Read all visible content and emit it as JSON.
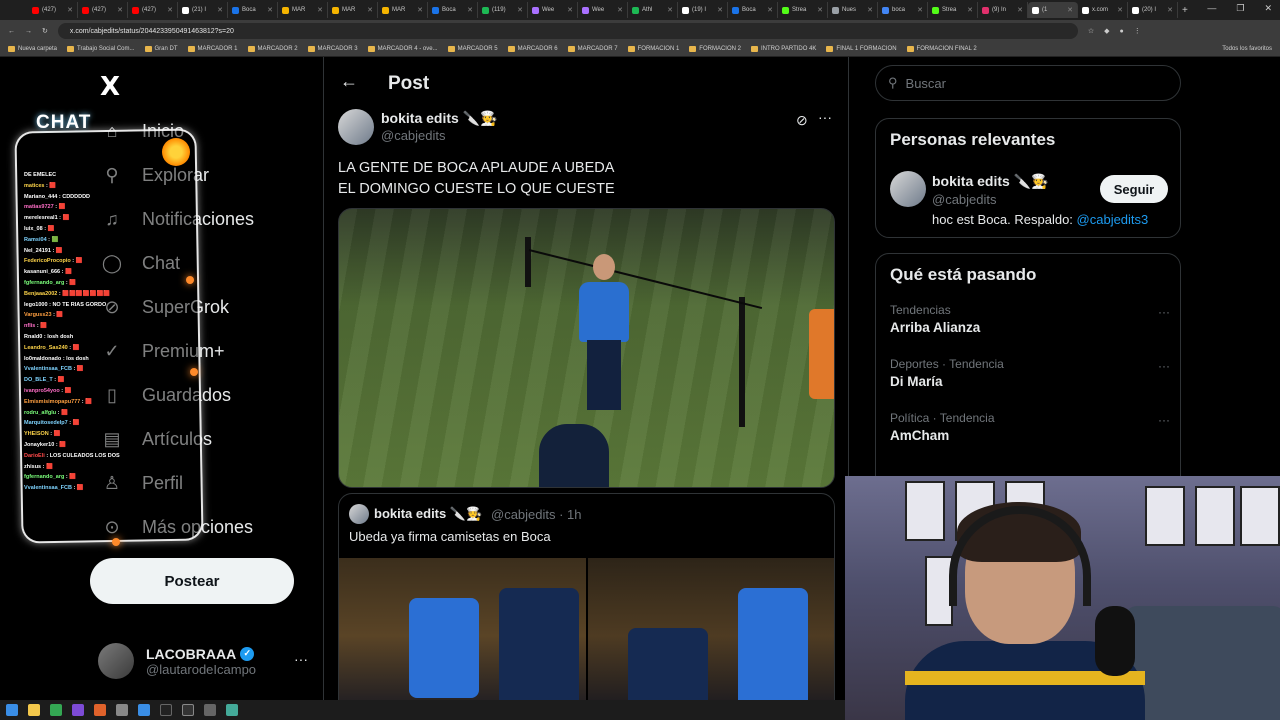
{
  "browser": {
    "tabs": [
      {
        "label": "(427)",
        "color": "#ff0000"
      },
      {
        "label": "(427)",
        "color": "#ff0000"
      },
      {
        "label": "(427)",
        "color": "#ff0000"
      },
      {
        "label": "(21) I",
        "color": "#ffffff"
      },
      {
        "label": "Boca",
        "color": "#1a73e8"
      },
      {
        "label": "MAR",
        "color": "#f5b400"
      },
      {
        "label": "MAR",
        "color": "#f5b400"
      },
      {
        "label": "MAR",
        "color": "#f5b400"
      },
      {
        "label": "Boca",
        "color": "#1a73e8"
      },
      {
        "label": "(119)",
        "color": "#1db954"
      },
      {
        "label": "Wee",
        "color": "#a970ff"
      },
      {
        "label": "Wee",
        "color": "#a970ff"
      },
      {
        "label": "Athl",
        "color": "#1db954"
      },
      {
        "label": "(19) I",
        "color": "#ffffff"
      },
      {
        "label": "Boca",
        "color": "#1a73e8"
      },
      {
        "label": "Strea",
        "color": "#53fc18"
      },
      {
        "label": "Nues",
        "color": "#9aa0a6"
      },
      {
        "label": "boca",
        "color": "#4285f4"
      },
      {
        "label": "Strea",
        "color": "#53fc18"
      },
      {
        "label": "(9) In",
        "color": "#e1306c"
      },
      {
        "label": "(1",
        "color": "#ffffff",
        "active": true
      },
      {
        "label": "x.com",
        "color": "#ffffff"
      },
      {
        "label": "(20) I",
        "color": "#ffffff"
      }
    ],
    "new_tab": "+",
    "url": "x.com/cabjedits/status/2044233950491463812?s=20",
    "bookmarks": [
      "Nueva carpeta",
      "Trabajo Social Com...",
      "Gran DT",
      "MARCADOR 1",
      "MARCADOR 2",
      "MARCADOR 3",
      "MARCADOR 4 - ove...",
      "MARCADOR 5",
      "MARCADOR 6",
      "MARCADOR 7",
      "FORMACION 1",
      "FORMACION 2",
      "INTRO PARTIDO 4K",
      "FINAL 1 FORMACION",
      "FORMACION FINAL 2"
    ],
    "bookmarks_right": "Todos los favoritos"
  },
  "nav": {
    "logo": "X",
    "items": [
      {
        "label": "Inicio",
        "icon": "home-icon",
        "glyph": "⌂"
      },
      {
        "label": "Explorar",
        "icon": "search-icon",
        "glyph": "⚲"
      },
      {
        "label": "Notificaciones",
        "icon": "bell-icon",
        "glyph": "♫"
      },
      {
        "label": "Chat",
        "icon": "chat-icon",
        "glyph": "◯"
      },
      {
        "label": "SuperGrok",
        "icon": "grok-icon",
        "glyph": "⊘"
      },
      {
        "label": "Premium+",
        "icon": "premium-icon",
        "glyph": "✓"
      },
      {
        "label": "Guardados",
        "icon": "bookmark-icon",
        "glyph": "▯"
      },
      {
        "label": "Artículos",
        "icon": "article-icon",
        "glyph": "▤"
      },
      {
        "label": "Perfil",
        "icon": "profile-icon",
        "glyph": "♙"
      },
      {
        "label": "Más opciones",
        "icon": "more-options-icon",
        "glyph": "⊙"
      }
    ],
    "post_button": "Postear",
    "account": {
      "name": "LACOBRAAA",
      "handle": "@lautarodeIcampo",
      "more": "···"
    }
  },
  "stream_chat": {
    "title": "CHAT",
    "lines": [
      {
        "user": "DE EMELEC",
        "color": "#ffffff",
        "msg": ""
      },
      {
        "user": "matices",
        "color": "#ffd54a",
        "msg": ": 🟥"
      },
      {
        "user": "Mariano_444",
        "color": "#ffffff",
        "msg": ": CDDDDDD"
      },
      {
        "user": "matias9727",
        "color": "#ff6ec7",
        "msg": ": 🟥"
      },
      {
        "user": "merelesreal1",
        "color": "#ffffff",
        "msg": ": 🟥"
      },
      {
        "user": "luix_08",
        "color": "#ffffff",
        "msg": ": 🟥"
      },
      {
        "user": "Ramsi04",
        "color": "#7fd4ff",
        "msg": ": 🟩"
      },
      {
        "user": "Nel_24191",
        "color": "#ffffff",
        "msg": ": 🟥"
      },
      {
        "user": "FedericoProcopio",
        "color": "#ffd54a",
        "msg": ": 🟥"
      },
      {
        "user": "kasanuni_666",
        "color": "#ffffff",
        "msg": ": 🟥"
      },
      {
        "user": "fgfernando_arg",
        "color": "#7bff7b",
        "msg": ": 🟥"
      },
      {
        "user": "Benjaaa2002",
        "color": "#ffd54a",
        "msg": ": 🟥🟥🟥🟥🟥🟥🟥"
      },
      {
        "user": "lego1000",
        "color": "#ffffff",
        "msg": ": NO TE RIAS GORDO"
      },
      {
        "user": "Varguss23",
        "color": "#ff9f40",
        "msg": ": 🟥"
      },
      {
        "user": "nflis",
        "color": "#ff6ec7",
        "msg": ": 🟥"
      },
      {
        "user": "Rnald0",
        "color": "#ffffff",
        "msg": ": losh dosh"
      },
      {
        "user": "Leandro_Sas240",
        "color": "#ffd54a",
        "msg": ": 🟥"
      },
      {
        "user": "lo0maldonado",
        "color": "#ffffff",
        "msg": ": los dosh"
      },
      {
        "user": "Vvalentinsaa_FCB",
        "color": "#7fd4ff",
        "msg": ": 🟥"
      },
      {
        "user": "DO_BLE_T",
        "color": "#7fd4ff",
        "msg": ": 🟥"
      },
      {
        "user": "ivanpro54yoo",
        "color": "#ff6ec7",
        "msg": ": 🟥"
      },
      {
        "user": "Elmismisimopapu777",
        "color": "#ff9f40",
        "msg": ": 🟥"
      },
      {
        "user": "rodru_alfglu",
        "color": "#7bff7b",
        "msg": ": 🟥"
      },
      {
        "user": "Marquitosedelp7",
        "color": "#7fd4ff",
        "msg": ": 🟥"
      },
      {
        "user": "YHEISON",
        "color": "#ffd54a",
        "msg": ": 🟥"
      },
      {
        "user": "Jonayker10",
        "color": "#ffffff",
        "msg": ": 🟥"
      },
      {
        "user": "DarioEli",
        "color": "#ff4a4a",
        "msg": ": LOS CULEADOS LOS DOS"
      },
      {
        "user": "zhisus",
        "color": "#ffffff",
        "msg": ": 🟥"
      },
      {
        "user": "fgfernando_arg",
        "color": "#7bff7b",
        "msg": ": 🟥"
      },
      {
        "user": "Vvalentinsaa_FCB",
        "color": "#7fd4ff",
        "msg": ": 🟥"
      }
    ]
  },
  "post": {
    "header_title": "Post",
    "author_name": "bokita edits 🔪🧑‍🍳",
    "author_handle": "@cabjedits",
    "text_line1": "LA GENTE DE BOCA APLAUDE A UBEDA",
    "text_line2": "EL DOMINGO CUESTE LO QUE CUESTE",
    "quote": {
      "author_name": "bokita edits 🔪🧑‍🍳",
      "author_handle": "@cabjedits · 1h",
      "text": "Ubeda ya firma camisetas en Boca"
    }
  },
  "sidebar": {
    "search_placeholder": "Buscar",
    "relevant": {
      "title": "Personas relevantes",
      "name": "bokita edits 🔪🧑‍🍳",
      "handle": "@cabjedits",
      "follow": "Seguir",
      "bio": "hoc est Boca. Respaldo: ",
      "bio_link": "@cabjedits3"
    },
    "trending": {
      "title": "Qué está pasando",
      "items": [
        {
          "category": "Tendencias",
          "name": "Arriba Alianza"
        },
        {
          "category": "Deportes · Tendencia",
          "name": "Di María"
        },
        {
          "category": "Política · Tendencia",
          "name": "AmCham"
        }
      ]
    }
  },
  "colors": {
    "accent": "#1d9bf0",
    "background": "#000000",
    "border": "#2f3336",
    "muted": "#71767b"
  }
}
